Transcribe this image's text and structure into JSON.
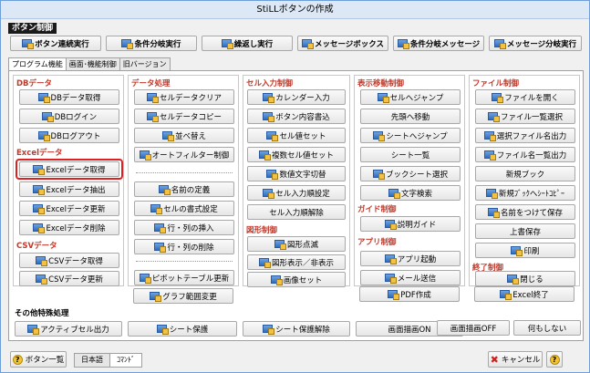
{
  "window": {
    "title": "StiLLボタンの作成"
  },
  "button_control": {
    "label": "ボタン制御",
    "buttons": [
      "ボタン連続実行",
      "条件分岐実行",
      "繰返し実行",
      "メッセージボックス",
      "条件分岐メッセージ",
      "メッセージ分岐実行"
    ]
  },
  "tabs": [
    "プログラム機能",
    "画面･機能制御",
    "旧バージョン"
  ],
  "columns": {
    "db": {
      "cat1": "DBデータ",
      "cat1_items": [
        "DBデータ取得",
        "DBログイン",
        "DBログアウト"
      ],
      "cat2": "Excelデータ",
      "cat2_items": [
        "Excelデータ取得",
        "Excelデータ抽出",
        "Excelデータ更新",
        "Excelデータ削除"
      ],
      "cat3": "CSVデータ",
      "cat3_items": [
        "CSVデータ取得",
        "CSVデータ更新"
      ]
    },
    "data": {
      "cat1": "データ処理",
      "items_a": [
        "セルデータクリア",
        "セルデータコピー",
        "並べ替え",
        "オートフィルター制御"
      ],
      "items_b": [
        "名前の定義",
        "セルの書式設定",
        "行・列の挿入",
        "行・列の削除"
      ],
      "items_c": [
        "ピボットテーブル更新",
        "グラフ範囲変更"
      ]
    },
    "cell": {
      "cat1": "セル入力制御",
      "items_a": [
        "カレンダー入力",
        "ボタン内容書込",
        "セル値セット",
        "複数セル値セット",
        "数値文字切替",
        "セル入力順設定",
        "セル入力順解除"
      ],
      "cat2": "図形制御",
      "items_b": [
        "図形点滅",
        "図形表示／非表示",
        "画像セット"
      ]
    },
    "move": {
      "cat1": "表示移動制御",
      "items_a": [
        "セルへジャンプ",
        "先頭へ移動",
        "シートへジャンプ",
        "シート一覧",
        "ブックシート選択",
        "文字検索"
      ],
      "cat2": "ガイド制御",
      "items_b": [
        "説明ガイド"
      ],
      "cat3": "アプリ制御",
      "items_c": [
        "アプリ起動",
        "メール送信",
        "PDF作成"
      ]
    },
    "file": {
      "cat1": "ファイル制御",
      "items_a": [
        "ファイルを開く",
        "ファイル一覧選択",
        "選択ファイル名出力",
        "ファイル名一覧出力",
        "新規ブック",
        "新規ﾌﾞｯｸへｼｰﾄｺﾋﾟｰ",
        "名前をつけて保存",
        "上書保存",
        "印刷"
      ],
      "cat2": "終了制御",
      "items_b": [
        "閉じる",
        "Excel終了"
      ]
    }
  },
  "other": {
    "label": "その他特殊処理",
    "buttons": [
      "アクティブセル出力",
      "シート保護",
      "シート保護解除",
      "画面描画ON",
      "画面描画OFF",
      "何もしない"
    ]
  },
  "footer": {
    "help": "ボタン一覧",
    "lang_on": "日本語",
    "lang_off": "ｺﾏﾝﾄﾞ",
    "cancel": "キャンセル",
    "q": "?"
  },
  "colors": {
    "category_red": "#c0392b",
    "highlight": "#e02020",
    "title_bg": "#dce8f6"
  }
}
